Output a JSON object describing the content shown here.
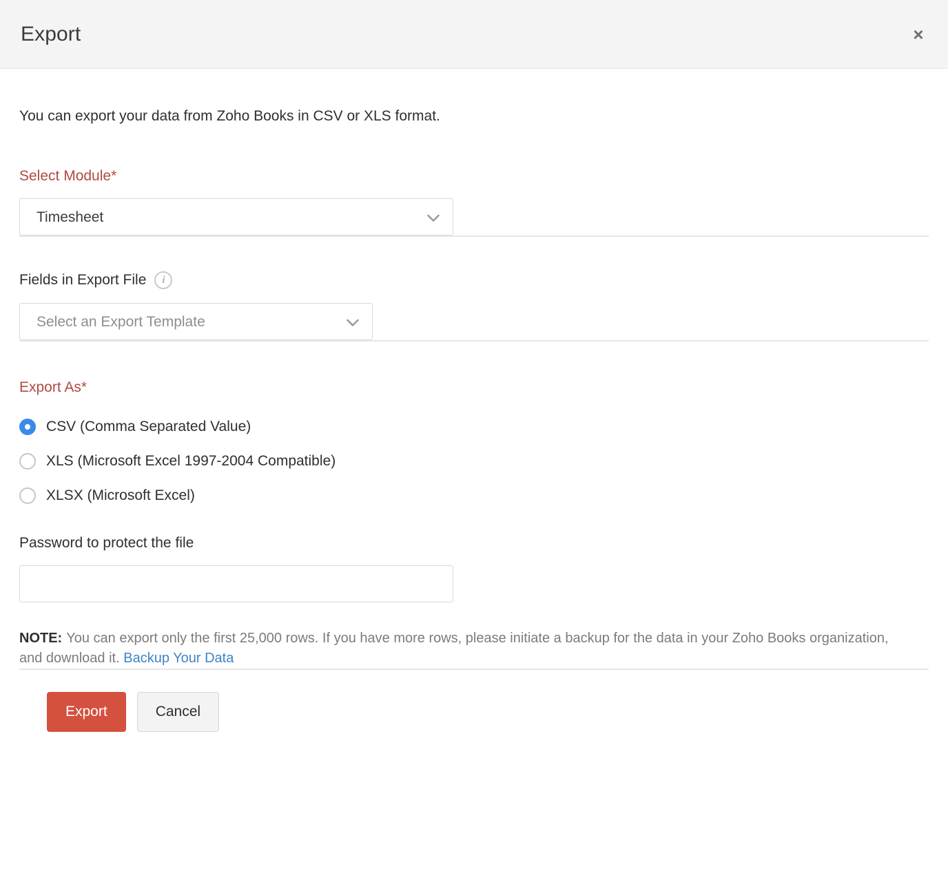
{
  "header": {
    "title": "Export",
    "close_label": "×"
  },
  "body": {
    "intro": "You can export your data from Zoho Books in CSV or XLS format.",
    "module": {
      "label": "Select Module*",
      "selected": "Timesheet",
      "options": [
        "Timesheet"
      ]
    },
    "fields": {
      "label": "Fields in Export File",
      "info_tooltip": "i",
      "template_placeholder": "Select an Export Template",
      "template_selected": "Select an Export Template",
      "options": [
        "Select an Export Template"
      ]
    },
    "export_as": {
      "label": "Export As*",
      "options": [
        {
          "label": "CSV (Comma Separated Value)",
          "checked": true
        },
        {
          "label": "XLS (Microsoft Excel 1997-2004 Compatible)",
          "checked": false
        },
        {
          "label": "XLSX (Microsoft Excel)",
          "checked": false
        }
      ]
    },
    "password": {
      "label": "Password to protect the file",
      "value": "",
      "placeholder": ""
    },
    "note": {
      "label": "NOTE:",
      "text": "You can export only the first 25,000 rows. If you have more rows, please initiate a backup for the data in your Zoho Books organization, and download it.",
      "link_text": "Backup Your Data"
    }
  },
  "footer": {
    "export_label": "Export",
    "cancel_label": "Cancel"
  },
  "colors": {
    "accent_red": "#d4503f",
    "required_label": "#b0493f",
    "radio_blue": "#3b8aea",
    "link_blue": "#3d84c6",
    "header_bg": "#f4f4f4",
    "divider": "#e6e6e6"
  }
}
